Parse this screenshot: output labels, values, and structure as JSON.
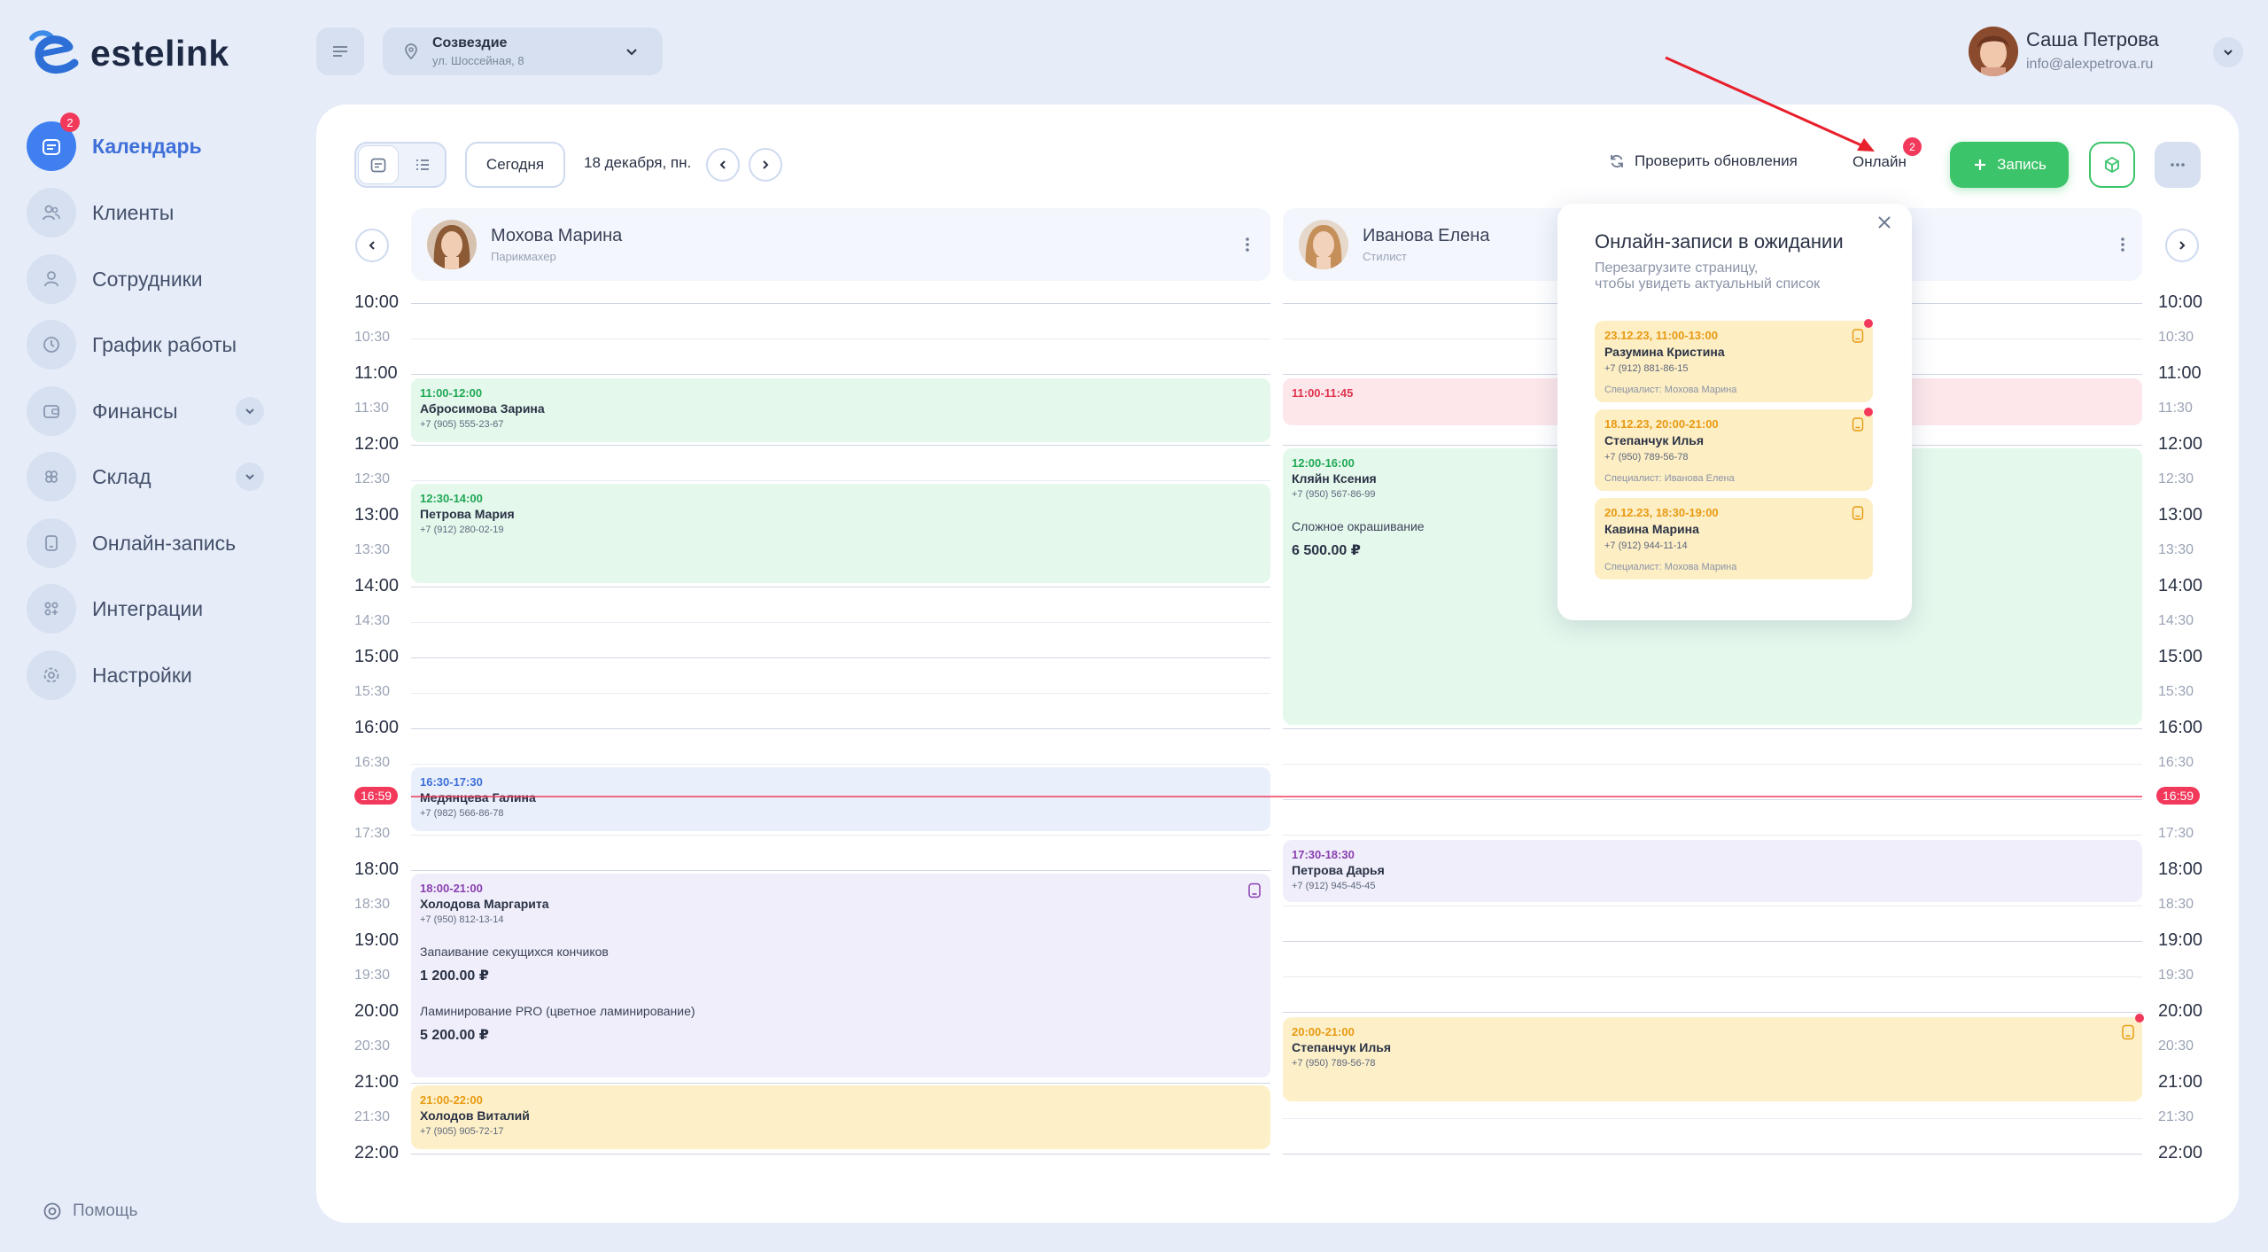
{
  "brand": {
    "name": "estelink"
  },
  "nav": {
    "items": [
      {
        "label": "Календарь",
        "badge": "2",
        "icon": "calendar-icon"
      },
      {
        "label": "Клиенты",
        "icon": "clients-icon"
      },
      {
        "label": "Сотрудники",
        "icon": "user-icon"
      },
      {
        "label": "График работы",
        "icon": "clock-icon"
      },
      {
        "label": "Финансы",
        "icon": "wallet-icon"
      },
      {
        "label": "Склад",
        "icon": "box-icon"
      },
      {
        "label": "Онлайн-запись",
        "icon": "phone-icon"
      },
      {
        "label": "Интеграции",
        "icon": "grid-icon"
      },
      {
        "label": "Настройки",
        "icon": "gear-icon"
      }
    ],
    "help_label": "Помощь"
  },
  "location": {
    "name": "Созвездие",
    "address": "ул. Шоссейная, 8"
  },
  "user": {
    "name": "Саша Петрова",
    "email": "info@alexpetrova.ru"
  },
  "toolbar": {
    "today_label": "Сегодня",
    "date_label": "18 декабря, пн.",
    "refresh_label": "Проверить обновления",
    "online_label": "Онлайн",
    "online_badge": "2",
    "add_label": "Запись"
  },
  "calendar": {
    "times": [
      "10:00",
      "10:30",
      "11:00",
      "11:30",
      "12:00",
      "12:30",
      "13:00",
      "13:30",
      "14:00",
      "14:30",
      "15:00",
      "15:30",
      "16:00",
      "16:30",
      "17:00",
      "17:30",
      "18:00",
      "18:30",
      "19:00",
      "19:30",
      "20:00",
      "20:30",
      "21:00",
      "21:30",
      "22:00"
    ],
    "current_time": "16:59",
    "employees": [
      {
        "name": "Мохова Марина",
        "role": "Парикмахер"
      },
      {
        "name": "Иванова Елена",
        "role": "Стилист"
      }
    ],
    "appointments": [
      {
        "time": "11:00-12:00",
        "name": "Абросимова Зарина",
        "phone": "+7 (905) 555-23-67"
      },
      {
        "time": "12:30-14:00",
        "name": "Петрова Мария",
        "phone": "+7 (912) 280-02-19"
      },
      {
        "time": "16:30-17:30",
        "name": "Медянцева Галина",
        "phone": "+7 (982) 566-86-78"
      },
      {
        "time": "18:00-21:00",
        "name": "Холодова Маргарита",
        "phone": "+7 (950) 812-13-14",
        "services": [
          {
            "name": "Запаивание секущихся кончиков",
            "price": "1 200.00 ₽"
          },
          {
            "name": "Ламинирование PRO (цветное ламинирование)",
            "price": "5 200.00 ₽"
          }
        ]
      },
      {
        "time": "21:00-22:00",
        "name": "Холодов Виталий",
        "phone": "+7 (905) 905-72-17"
      },
      {
        "time": "11:00-11:45"
      },
      {
        "time": "12:00-16:00",
        "name": "Кляйн Ксения",
        "phone": "+7 (950) 567-86-99",
        "services": [
          {
            "name": "Сложное окрашивание",
            "price": "6 500.00 ₽"
          }
        ]
      },
      {
        "time": "17:30-18:30",
        "name": "Петрова Дарья",
        "phone": "+7 (912) 945-45-45"
      },
      {
        "time": "20:00-21:00",
        "name": "Степанчук Илья",
        "phone": "+7 (950) 789-56-78"
      }
    ]
  },
  "popup": {
    "title": "Онлайн-записи в ожидании",
    "subtitle_1": "Перезагрузите страницу,",
    "subtitle_2": "чтобы увидеть актуальный список",
    "items": [
      {
        "time": "23.12.23, 11:00-13:00",
        "name": "Разумина Кристина",
        "phone": "+7 (912) 881-86-15",
        "specialist": "Специалист: Мохова Марина"
      },
      {
        "time": "18.12.23, 20:00-21:00",
        "name": "Степанчук Илья",
        "phone": "+7 (950) 789-56-78",
        "specialist": "Специалист: Иванова Елена"
      },
      {
        "time": "20.12.23, 18:30-19:00",
        "name": "Кавина Марина",
        "phone": "+7 (912) 944-11-14",
        "specialist": "Специалист: Мохова Марина"
      }
    ]
  },
  "colors": {
    "accent": "#3f7ff0",
    "add_button": "#3cc46a",
    "badge": "#f2395b",
    "now_line": "#f2395b"
  }
}
